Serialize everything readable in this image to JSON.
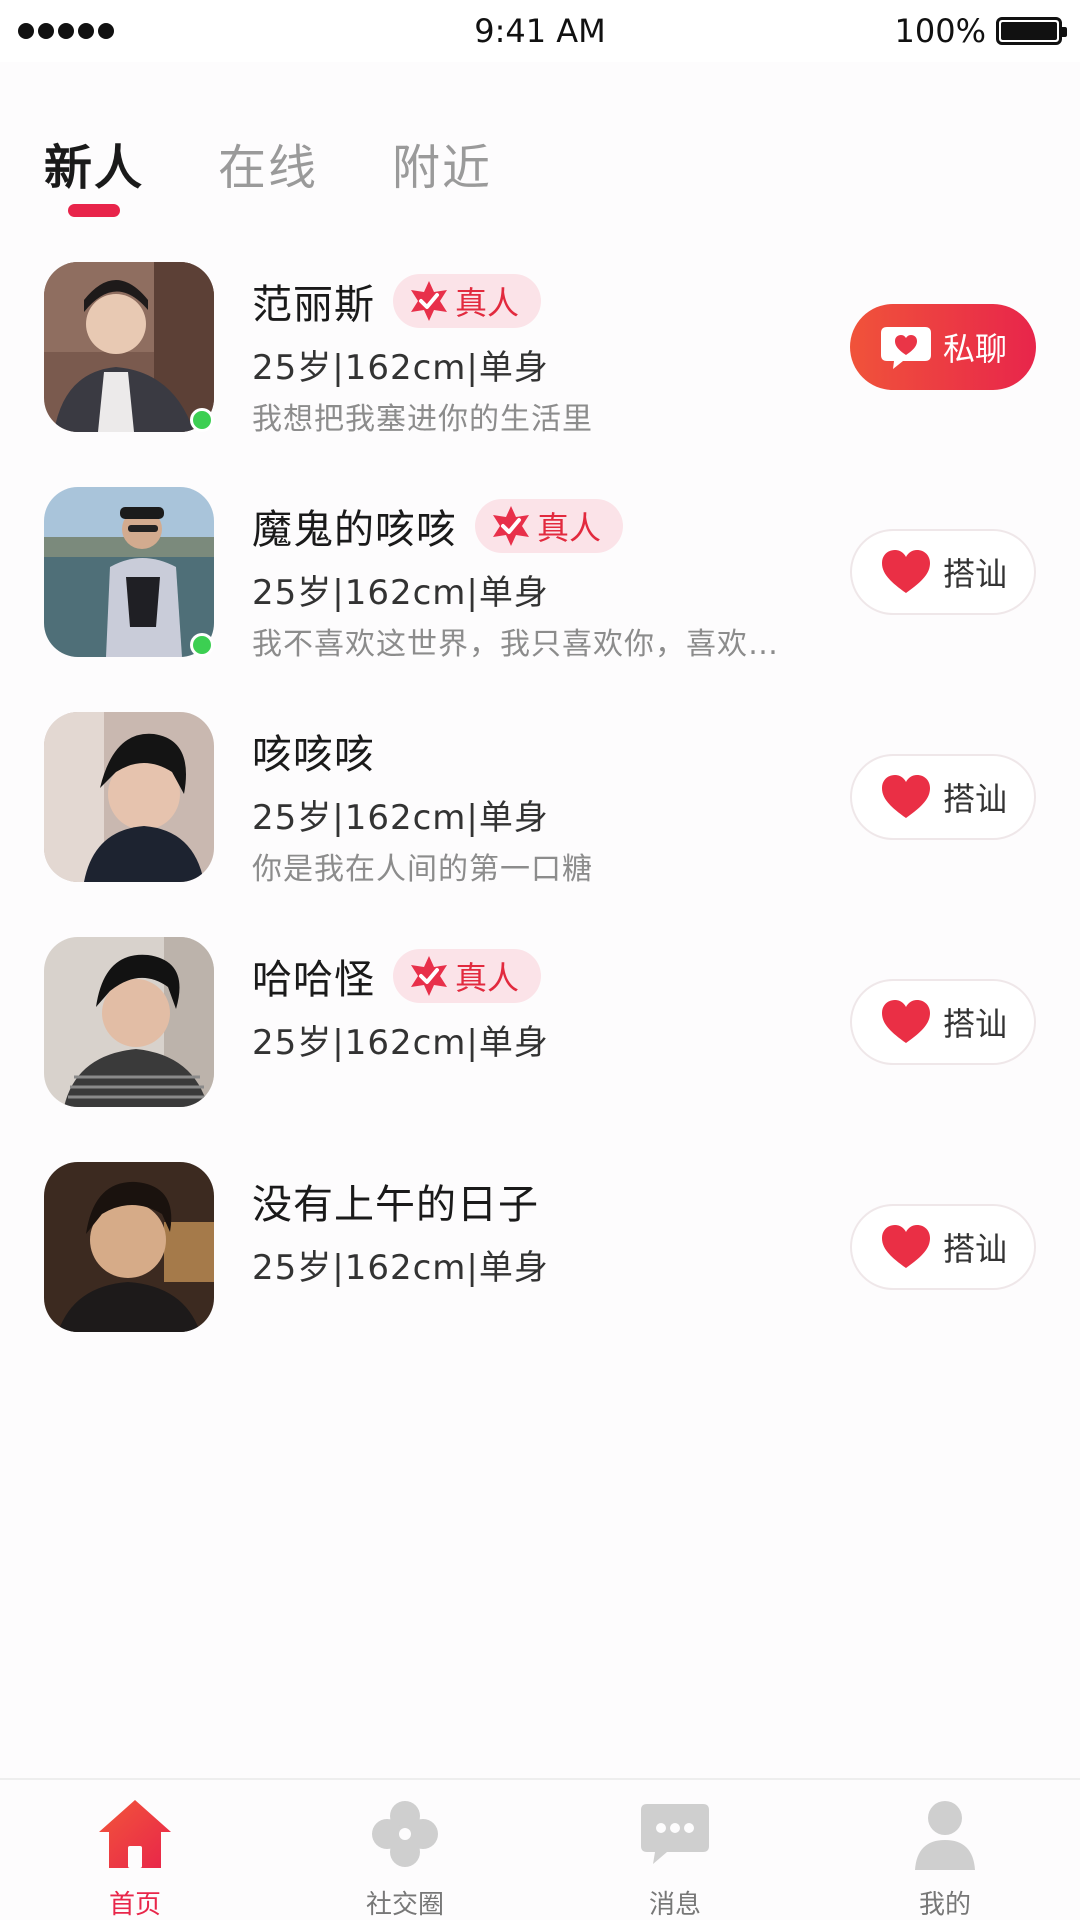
{
  "status_bar": {
    "time": "9:41 AM",
    "battery": "100%"
  },
  "tabs": [
    {
      "label": "新人",
      "active": true
    },
    {
      "label": "在线",
      "active": false
    },
    {
      "label": "附近",
      "active": false
    }
  ],
  "users": [
    {
      "name": "范丽斯",
      "verified": true,
      "badge": "真人",
      "info": "25岁|162cm|单身",
      "bio": "我想把我塞进你的生活里",
      "online": true,
      "button": "私聊",
      "button_type": "chat"
    },
    {
      "name": "魔鬼的咳咳",
      "verified": true,
      "badge": "真人",
      "info": "25岁|162cm|单身",
      "bio": "我不喜欢这世界，我只喜欢你，喜欢…",
      "online": true,
      "button": "搭讪",
      "button_type": "greet"
    },
    {
      "name": "咳咳咳",
      "verified": false,
      "badge": "",
      "info": "25岁|162cm|单身",
      "bio": "你是我在人间的第一口糖",
      "online": false,
      "button": "搭讪",
      "button_type": "greet"
    },
    {
      "name": "哈哈怪",
      "verified": true,
      "badge": "真人",
      "info": "25岁|162cm|单身",
      "bio": "",
      "online": false,
      "button": "搭讪",
      "button_type": "greet"
    },
    {
      "name": "没有上午的日子",
      "verified": false,
      "badge": "",
      "info": "25岁|162cm|单身",
      "bio": "",
      "online": false,
      "button": "搭讪",
      "button_type": "greet"
    }
  ],
  "bottom_nav": [
    {
      "label": "首页",
      "icon": "home-icon",
      "active": true
    },
    {
      "label": "社交圈",
      "icon": "clover-icon",
      "active": false
    },
    {
      "label": "消息",
      "icon": "message-icon",
      "active": false
    },
    {
      "label": "我的",
      "icon": "person-icon",
      "active": false
    }
  ],
  "colors": {
    "accent": "#e8244a",
    "online": "#3ccf52",
    "badge_bg": "#fbe3e8"
  }
}
